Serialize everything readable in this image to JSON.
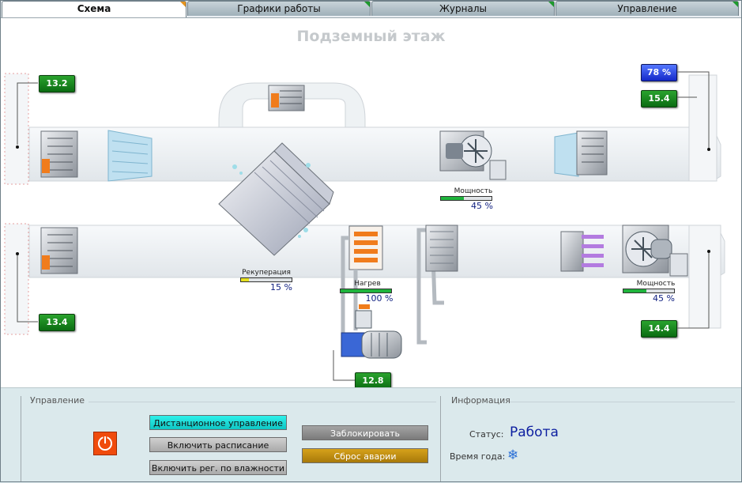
{
  "tabs": [
    {
      "label": "Схема",
      "active": true
    },
    {
      "label": "Графики работы",
      "active": false
    },
    {
      "label": "Журналы",
      "active": false
    },
    {
      "label": "Управление",
      "active": false
    }
  ],
  "scheme": {
    "title": "Подземный этаж",
    "temps": {
      "outdoor_top": "13.2 °C",
      "outdoor_bottom": "13.4 °C",
      "supply": "15.4 °C",
      "exhaust": "14.4 °C",
      "heater_water": "12.8 °C",
      "humidity": "78 %"
    },
    "supply_fan": {
      "label": "Мощность",
      "value": "45 %",
      "percent": 45
    },
    "exhaust_fan": {
      "label": "Мощность",
      "value": "45 %",
      "percent": 45
    },
    "recuperation": {
      "label": "Рекуперация",
      "value": "15 %",
      "percent": 15
    },
    "heating": {
      "label": "Нагрев",
      "value": "100 %",
      "percent": 100
    }
  },
  "control": {
    "title": "Управление",
    "remote_label": "Дистанционное управление",
    "schedule_label": "Включить расписание",
    "humidity_label": "Включить рег. по влажности",
    "lock_label": "Заблокировать",
    "reset_label": "Сброс аварии"
  },
  "info": {
    "title": "Информация",
    "status_label": "Статус:",
    "status_value": "Работа",
    "season_label": "Время года:",
    "season_icon": "snowflake-icon"
  },
  "colors": {
    "temp_green": "#0b6c12",
    "humidity_blue": "#1428c8",
    "meter_green": "#1fb43c",
    "status_blue": "#0c1ea0",
    "power_orange": "#f04b0c"
  }
}
